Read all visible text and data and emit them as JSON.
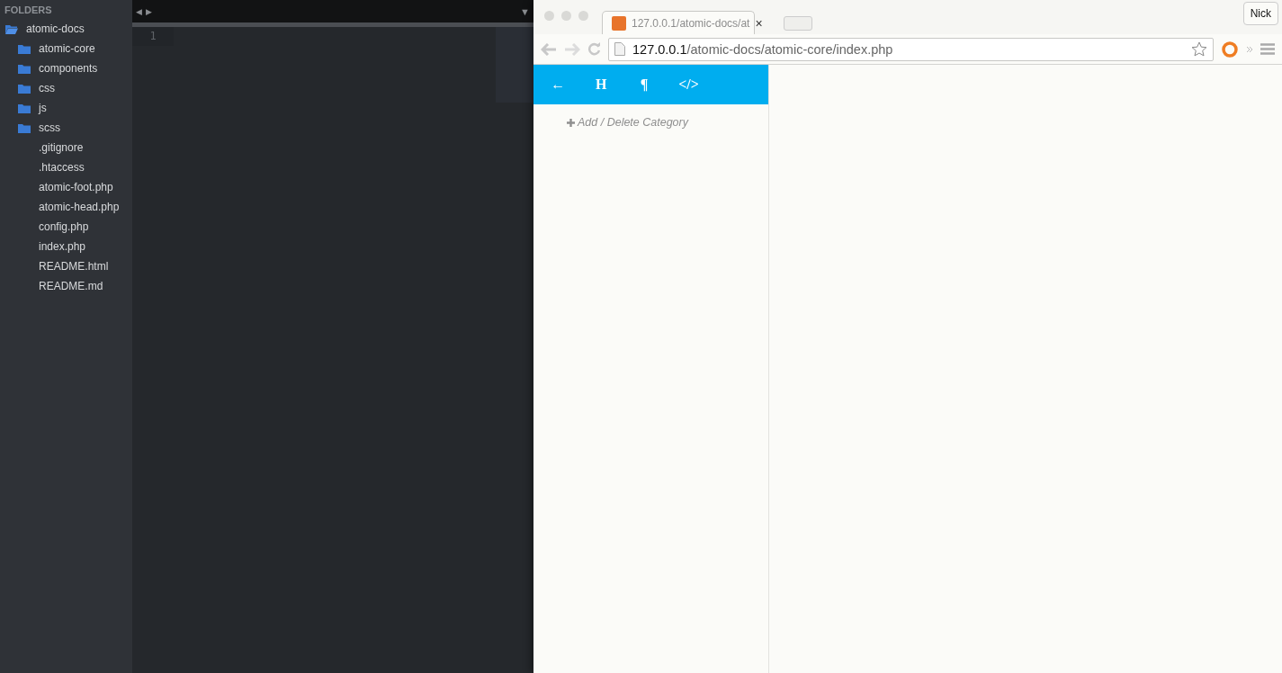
{
  "sidebar": {
    "heading": "FOLDERS",
    "tree": [
      {
        "label": "atomic-docs",
        "kind": "folder",
        "expanded": true,
        "children": [
          {
            "label": "atomic-core",
            "kind": "folder",
            "expanded": false
          },
          {
            "label": "components",
            "kind": "folder",
            "expanded": false
          },
          {
            "label": "css",
            "kind": "folder",
            "expanded": false
          },
          {
            "label": "js",
            "kind": "folder",
            "expanded": false
          },
          {
            "label": "scss",
            "kind": "folder",
            "expanded": false
          },
          {
            "label": ".gitignore",
            "kind": "file"
          },
          {
            "label": ".htaccess",
            "kind": "file"
          },
          {
            "label": "atomic-foot.php",
            "kind": "file"
          },
          {
            "label": "atomic-head.php",
            "kind": "file"
          },
          {
            "label": "config.php",
            "kind": "file"
          },
          {
            "label": "index.php",
            "kind": "file"
          },
          {
            "label": "README.html",
            "kind": "file"
          },
          {
            "label": "README.md",
            "kind": "file"
          }
        ]
      }
    ]
  },
  "editor": {
    "nav": [
      "◀",
      "▶"
    ],
    "menu": "▼",
    "line_numbers": [
      "1"
    ]
  },
  "browser": {
    "tab": {
      "title": "127.0.0.1/atomic-docs/at",
      "close": "×"
    },
    "profile": "Nick",
    "address": {
      "host": "127.0.0.1",
      "path": "/atomic-docs/atomic-core/index.php"
    },
    "toolbar": [
      "←",
      "H",
      "¶",
      "</>"
    ],
    "add_category": "Add / Delete Category"
  }
}
